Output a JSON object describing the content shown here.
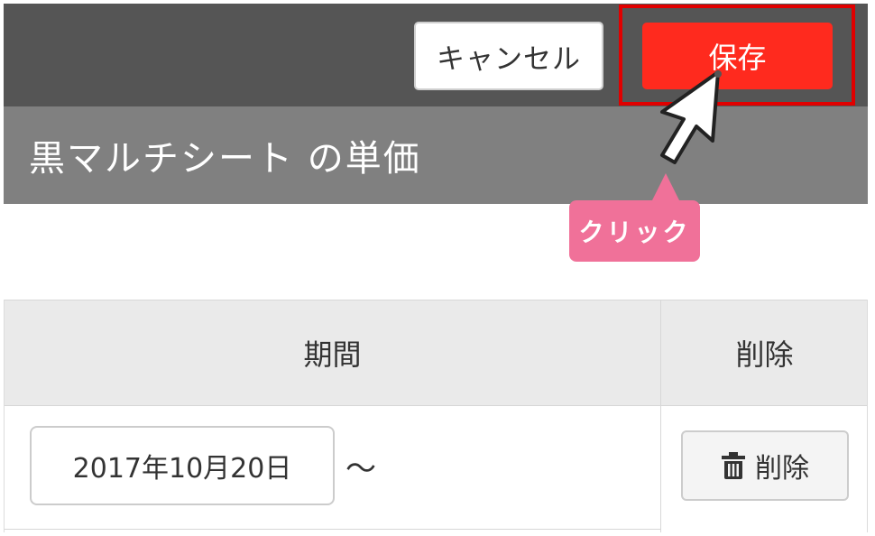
{
  "toolbar": {
    "cancel_label": "キャンセル",
    "save_label": "保存"
  },
  "header": {
    "title": "黒マルチシート の単価"
  },
  "annotation": {
    "tooltip_label": "クリック"
  },
  "table": {
    "columns": [
      "期間",
      "削除"
    ],
    "rows": [
      {
        "date_value": "2017年10月20日",
        "range_separator": "〜",
        "delete_label": "削除"
      }
    ]
  },
  "icons": {
    "trash": "trash-icon",
    "cursor": "mouse-pointer-icon"
  },
  "colors": {
    "save_button": "#ff2a1e",
    "highlight_border": "#e00000",
    "tooltip_bg": "#f07199",
    "topbar_bg": "#555555",
    "titlebar_bg": "#808080"
  }
}
